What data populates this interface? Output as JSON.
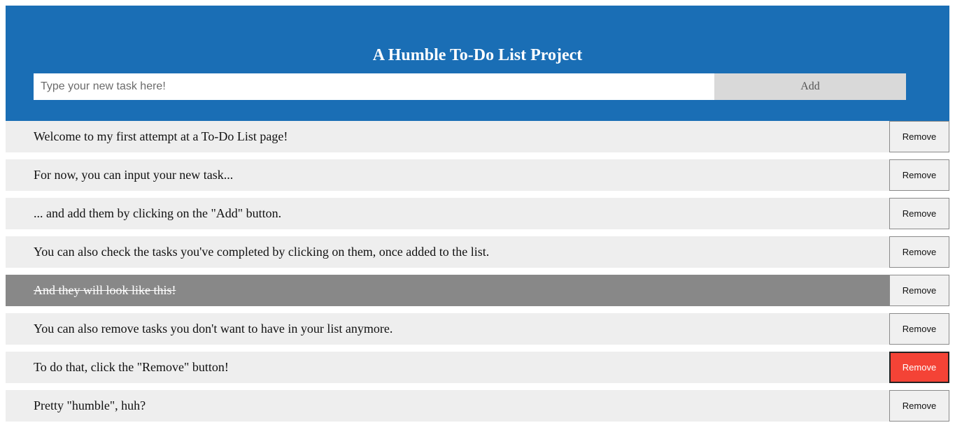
{
  "header": {
    "title": "A Humble To-Do List Project",
    "input_placeholder": "Type your new task here!",
    "add_label": "Add"
  },
  "tasks": [
    {
      "text": "Welcome to my first attempt at a To-Do List page!",
      "completed": false,
      "remove_label": "Remove"
    },
    {
      "text": "For now, you can input your new task...",
      "completed": false,
      "remove_label": "Remove"
    },
    {
      "text": "... and add them by clicking on the \"Add\" button.",
      "completed": false,
      "remove_label": "Remove"
    },
    {
      "text": "You can also check the tasks you've completed by clicking on them, once added to the list.",
      "completed": false,
      "remove_label": "Remove"
    },
    {
      "text": "And they will look like this!",
      "completed": true,
      "remove_label": "Remove"
    },
    {
      "text": "You can also remove tasks you don't want to have in your list anymore.",
      "completed": false,
      "remove_label": "Remove"
    },
    {
      "text": "To do that, click the \"Remove\" button!",
      "completed": false,
      "remove_label": "Remove",
      "remove_hovered": true
    },
    {
      "text": "Pretty \"humble\", huh?",
      "completed": false,
      "remove_label": "Remove"
    }
  ],
  "colors": {
    "header_bg": "#1a6eb5",
    "row_bg": "#eeeeee",
    "completed_bg": "#888888",
    "remove_hover_bg": "#f44336"
  }
}
